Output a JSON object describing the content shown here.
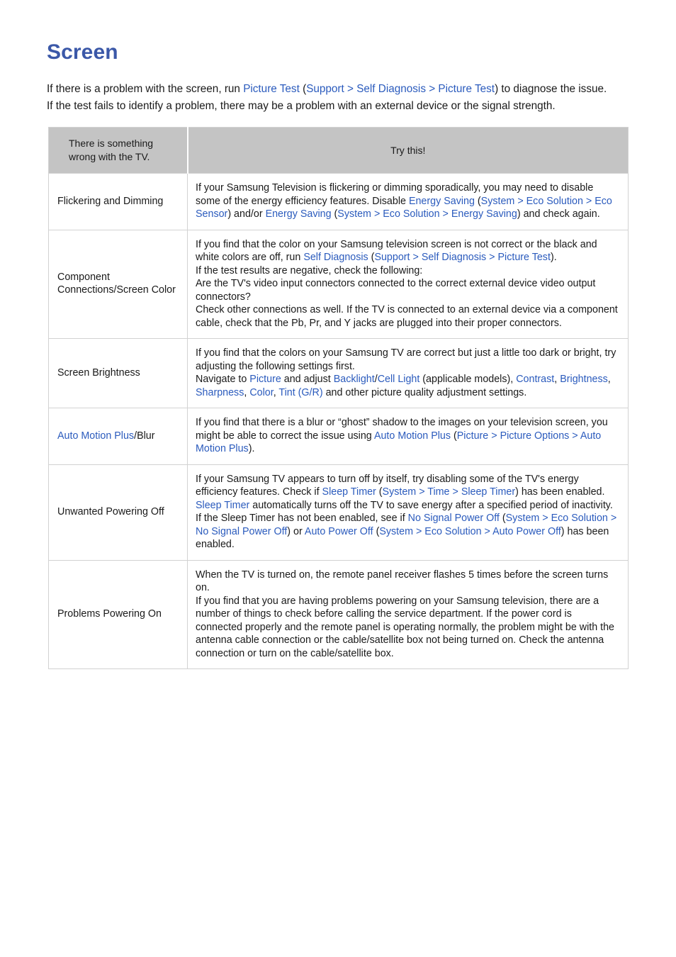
{
  "page": {
    "title": "Screen",
    "intro_segments": [
      {
        "t": "If there is a problem with the screen, run ",
        "k": "plain"
      },
      {
        "t": "Picture Test",
        "k": "link"
      },
      {
        "t": " (",
        "k": "plain"
      },
      {
        "t": "Support",
        "k": "link"
      },
      {
        "t": " > ",
        "k": "sep"
      },
      {
        "t": "Self Diagnosis",
        "k": "link"
      },
      {
        "t": " > ",
        "k": "sep"
      },
      {
        "t": "Picture Test",
        "k": "link"
      },
      {
        "t": ") to diagnose the issue. If the test fails to identify a problem, there may be a problem with an external device or the signal strength.",
        "k": "plain"
      }
    ]
  },
  "table": {
    "headers": {
      "col1": "There is something wrong with the TV.",
      "col1_line1": "There is something",
      "col1_line2": "wrong with the TV.",
      "col2": "Try this!"
    },
    "rows": [
      {
        "label": "Flickering and Dimming",
        "label_segments": [
          {
            "t": "Flickering and Dimming",
            "k": "plain"
          }
        ],
        "body_segments": [
          {
            "t": "If your Samsung Television is flickering or dimming sporadically, you may need to disable some of the energy efficiency features. Disable ",
            "k": "plain"
          },
          {
            "t": "Energy Saving",
            "k": "link"
          },
          {
            "t": " (",
            "k": "plain"
          },
          {
            "t": "System",
            "k": "link"
          },
          {
            "t": " > ",
            "k": "sep"
          },
          {
            "t": "Eco Solution",
            "k": "link"
          },
          {
            "t": " > ",
            "k": "sep"
          },
          {
            "t": "Eco Sensor",
            "k": "link"
          },
          {
            "t": ") and/or ",
            "k": "plain"
          },
          {
            "t": "Energy Saving",
            "k": "link"
          },
          {
            "t": " (",
            "k": "plain"
          },
          {
            "t": "System",
            "k": "link"
          },
          {
            "t": " > ",
            "k": "sep"
          },
          {
            "t": "Eco Solution",
            "k": "link"
          },
          {
            "t": " > ",
            "k": "sep"
          },
          {
            "t": "Energy Saving",
            "k": "link"
          },
          {
            "t": ") and check again.",
            "k": "plain"
          }
        ]
      },
      {
        "label": "Component Connections/Screen Color",
        "label_segments": [
          {
            "t": "Component Connections/Screen Color",
            "k": "plain"
          }
        ],
        "body_segments": [
          {
            "t": "If you find that the color on your Samsung television screen is not correct or the black and white colors are off, run ",
            "k": "plain"
          },
          {
            "t": "Self Diagnosis",
            "k": "link"
          },
          {
            "t": " (",
            "k": "plain"
          },
          {
            "t": "Support",
            "k": "link"
          },
          {
            "t": " > ",
            "k": "sep"
          },
          {
            "t": "Self Diagnosis",
            "k": "link"
          },
          {
            "t": " > ",
            "k": "sep"
          },
          {
            "t": "Picture Test",
            "k": "link"
          },
          {
            "t": ").",
            "k": "plain"
          },
          {
            "t": "BR",
            "k": "br"
          },
          {
            "t": "If the test results are negative, check the following:",
            "k": "plain"
          },
          {
            "t": "BR",
            "k": "br"
          },
          {
            "t": "Are the TV's video input connectors connected to the correct external device video output connectors?",
            "k": "plain"
          },
          {
            "t": "BR",
            "k": "br"
          },
          {
            "t": "Check other connections as well. If the TV is connected to an external device via a component cable, check that the Pb, Pr, and Y jacks are plugged into their proper connectors.",
            "k": "plain"
          }
        ]
      },
      {
        "label": "Screen Brightness",
        "label_segments": [
          {
            "t": "Screen Brightness",
            "k": "plain"
          }
        ],
        "body_segments": [
          {
            "t": "If you find that the colors on your Samsung TV are correct but just a little too dark or bright, try adjusting the following settings first.",
            "k": "plain"
          },
          {
            "t": "BR",
            "k": "br"
          },
          {
            "t": "Navigate to ",
            "k": "plain"
          },
          {
            "t": "Picture",
            "k": "link"
          },
          {
            "t": " and adjust ",
            "k": "plain"
          },
          {
            "t": "Backlight",
            "k": "link"
          },
          {
            "t": "/",
            "k": "plain"
          },
          {
            "t": "Cell Light",
            "k": "link"
          },
          {
            "t": " (applicable models), ",
            "k": "plain"
          },
          {
            "t": "Contrast",
            "k": "link"
          },
          {
            "t": ", ",
            "k": "plain"
          },
          {
            "t": "Brightness",
            "k": "link"
          },
          {
            "t": ", ",
            "k": "plain"
          },
          {
            "t": "Sharpness",
            "k": "link"
          },
          {
            "t": ", ",
            "k": "plain"
          },
          {
            "t": "Color",
            "k": "link"
          },
          {
            "t": ", ",
            "k": "plain"
          },
          {
            "t": "Tint (G/R)",
            "k": "link"
          },
          {
            "t": " and other picture quality adjustment settings.",
            "k": "plain"
          }
        ]
      },
      {
        "label": "Auto Motion Plus/Blur",
        "label_segments": [
          {
            "t": "Auto Motion Plus",
            "k": "link"
          },
          {
            "t": "/Blur",
            "k": "plain"
          }
        ],
        "body_segments": [
          {
            "t": "If you find that there is a blur or “ghost” shadow to the images on your television screen, you might be able to correct the issue using ",
            "k": "plain"
          },
          {
            "t": "Auto Motion Plus",
            "k": "link"
          },
          {
            "t": " (",
            "k": "plain"
          },
          {
            "t": "Picture",
            "k": "link"
          },
          {
            "t": " > ",
            "k": "sep"
          },
          {
            "t": "Picture Options",
            "k": "link"
          },
          {
            "t": " > ",
            "k": "sep"
          },
          {
            "t": "Auto Motion Plus",
            "k": "link"
          },
          {
            "t": ").",
            "k": "plain"
          }
        ]
      },
      {
        "label": "Unwanted Powering Off",
        "label_segments": [
          {
            "t": "Unwanted Powering Off",
            "k": "plain"
          }
        ],
        "body_segments": [
          {
            "t": "If your Samsung TV appears to turn off by itself, try disabling some of the TV's energy efficiency features. Check if ",
            "k": "plain"
          },
          {
            "t": "Sleep Timer",
            "k": "link"
          },
          {
            "t": " (",
            "k": "plain"
          },
          {
            "t": "System",
            "k": "link"
          },
          {
            "t": " > ",
            "k": "sep"
          },
          {
            "t": "Time",
            "k": "link"
          },
          {
            "t": " > ",
            "k": "sep"
          },
          {
            "t": "Sleep Timer",
            "k": "link"
          },
          {
            "t": ") has been enabled. ",
            "k": "plain"
          },
          {
            "t": "Sleep Timer",
            "k": "link"
          },
          {
            "t": " automatically turns off the TV to save energy after a specified period of inactivity. If the Sleep Timer has not been enabled, see if ",
            "k": "plain"
          },
          {
            "t": "No Signal Power Off",
            "k": "link"
          },
          {
            "t": " (",
            "k": "plain"
          },
          {
            "t": "System",
            "k": "link"
          },
          {
            "t": " > ",
            "k": "sep"
          },
          {
            "t": "Eco Solution",
            "k": "link"
          },
          {
            "t": " > ",
            "k": "sep"
          },
          {
            "t": "No Signal Power Off",
            "k": "link"
          },
          {
            "t": ") or ",
            "k": "plain"
          },
          {
            "t": "Auto Power Off",
            "k": "link"
          },
          {
            "t": " (",
            "k": "plain"
          },
          {
            "t": "System",
            "k": "link"
          },
          {
            "t": " > ",
            "k": "sep"
          },
          {
            "t": "Eco Solution",
            "k": "link"
          },
          {
            "t": " > ",
            "k": "sep"
          },
          {
            "t": "Auto Power Off",
            "k": "link"
          },
          {
            "t": ") has been enabled.",
            "k": "plain"
          }
        ]
      },
      {
        "label": "Problems Powering On",
        "label_segments": [
          {
            "t": "Problems Powering On",
            "k": "plain"
          }
        ],
        "body_segments": [
          {
            "t": "When the TV is turned on, the remote panel receiver flashes 5 times before the screen turns on.",
            "k": "plain"
          },
          {
            "t": "BR",
            "k": "br"
          },
          {
            "t": "If you find that you are having problems powering on your Samsung television, there are a number of things to check before calling the service department. If the power cord is connected properly and the remote panel is operating normally, the problem might be with the antenna cable connection or the cable/satellite box not being turned on. Check the antenna connection or turn on the cable/satellite box.",
            "k": "plain"
          }
        ]
      }
    ]
  },
  "colors": {
    "heading": "#3b58a8",
    "link": "#2b5bbd",
    "text": "#1a1a1a",
    "header_bg": "#c4c4c4",
    "border": "#d2d2d2"
  }
}
